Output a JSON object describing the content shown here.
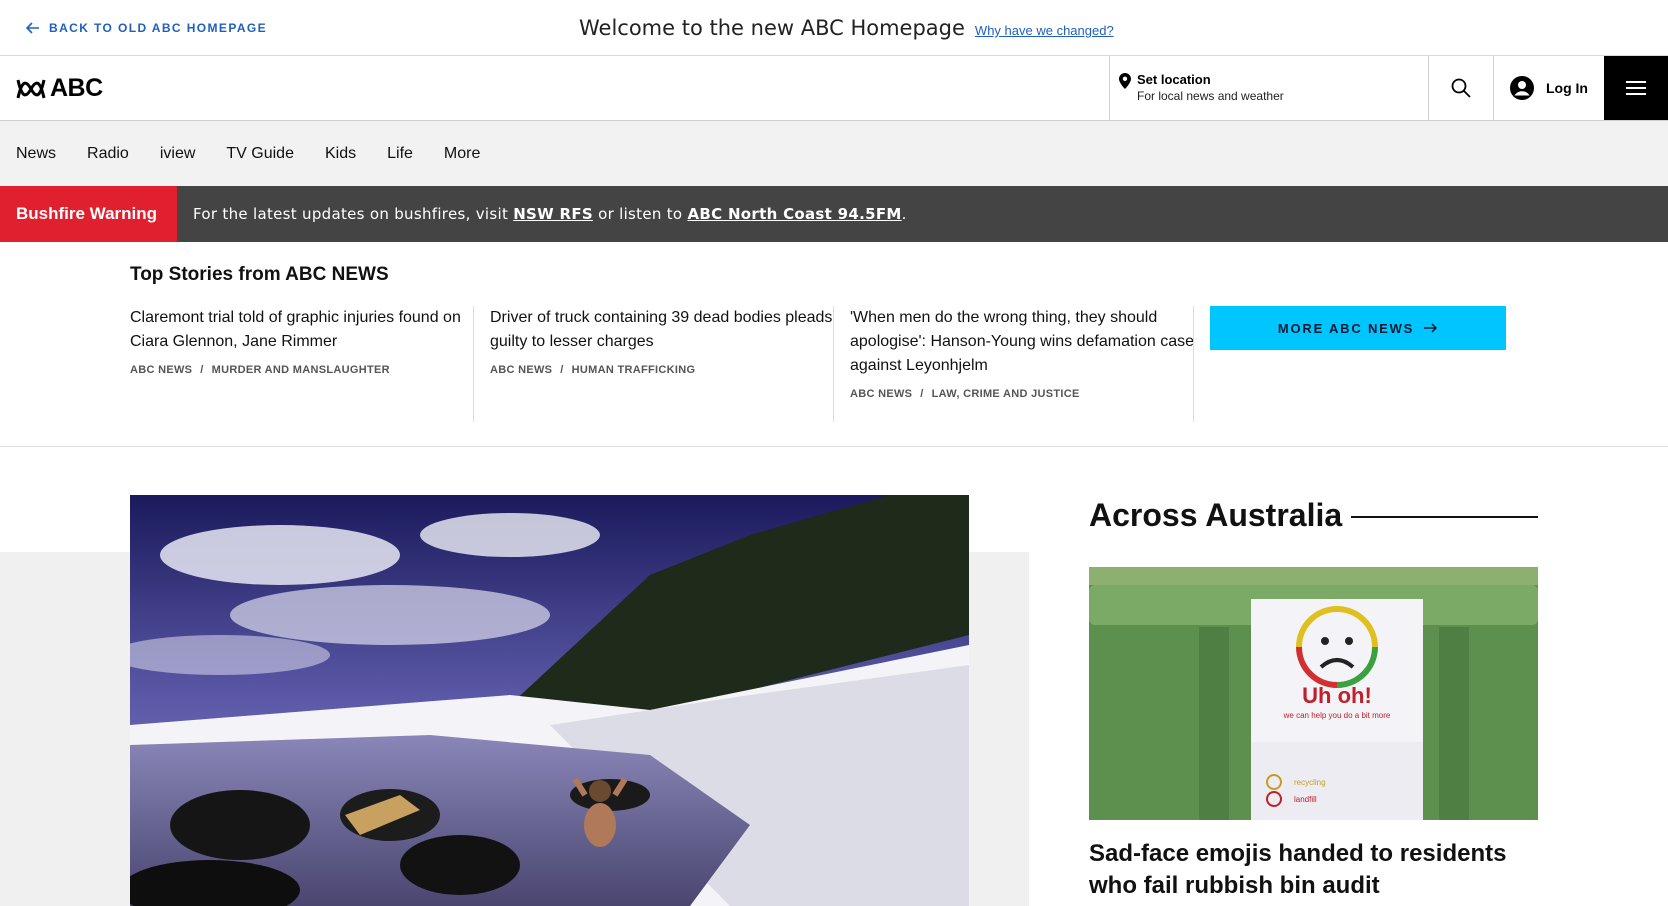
{
  "notice": {
    "back_label": "BACK TO OLD ABC HOMEPAGE",
    "welcome": "Welcome to the new ABC Homepage",
    "why_link": "Why have we changed?"
  },
  "header": {
    "logo_text": "ABC",
    "location_title": "Set location",
    "location_sub": "For local news and weather",
    "login_label": "Log In"
  },
  "nav": {
    "items": [
      "News",
      "Radio",
      "iview",
      "TV Guide",
      "Kids",
      "Life",
      "More"
    ]
  },
  "alert": {
    "tag": "Bushfire Warning",
    "msg_prefix": "For the latest updates on bushfires, visit ",
    "link1": "NSW RFS",
    "msg_mid": " or listen to ",
    "link2": "ABC North Coast 94.5FM",
    "msg_suffix": "."
  },
  "top_stories": {
    "title": "Top Stories from ABC NEWS",
    "items": [
      {
        "headline": "Claremont trial told of graphic injuries found on Ciara Glennon, Jane Rimmer",
        "source": "ABC NEWS",
        "sep": "/",
        "topic": "MURDER AND MANSLAUGHTER"
      },
      {
        "headline": "Driver of truck containing 39 dead bodies pleads guilty to lesser charges",
        "source": "ABC NEWS",
        "sep": "/",
        "topic": "HUMAN TRAFFICKING"
      },
      {
        "headline": "'When men do the wrong thing, they should apologise': Hanson-Young wins defamation case against Leyonhjelm",
        "source": "ABC NEWS",
        "sep": "/",
        "topic": "LAW, CRIME AND JUSTICE"
      }
    ],
    "more_label": "MORE ABC NEWS"
  },
  "across": {
    "title": "Across Australia",
    "headline": "Sad-face emojis handed to residents who fail rubbish bin audit",
    "sign_text1": "Uh oh!",
    "sign_text2": "we can help you do a bit more",
    "sign_text3": "recycling",
    "sign_text4": "landfill"
  },
  "colors": {
    "accent_blue": "#1f5fbf",
    "alert_red": "#e0202e",
    "more_button": "#00c6ff"
  }
}
